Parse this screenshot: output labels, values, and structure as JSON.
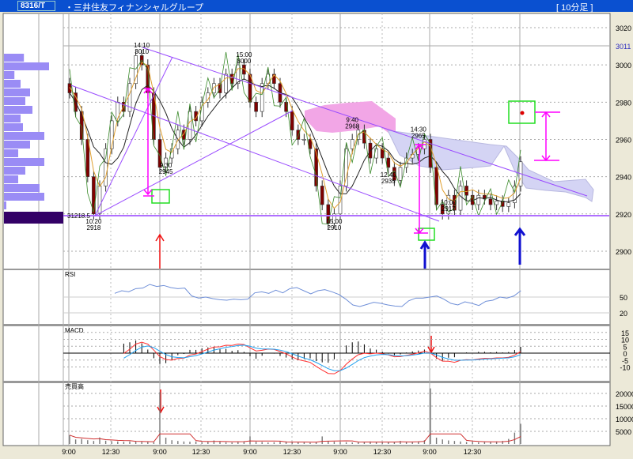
{
  "header": {
    "symbol": "8316/T",
    "name": "・三井住友フィナンシャルグループ",
    "period": "[ 10分足 ]"
  },
  "chart_data": {
    "type": "candlestick",
    "price_axis": {
      "ticks": [
        3020,
        3000,
        2980,
        2960,
        2940,
        2920,
        2900
      ],
      "ylim": [
        2893,
        3027
      ],
      "marker": "3011"
    },
    "time_ticks": [
      "9:00",
      "12:30",
      "9:00",
      "12:30",
      "9:00",
      "12:30",
      "9:00",
      "12:30",
      "9:00",
      "12:30"
    ],
    "closes": [
      2985,
      2975,
      2960,
      2940,
      2920,
      2935,
      2955,
      2970,
      2980,
      2975,
      2990,
      3005,
      3000,
      2985,
      2960,
      2945,
      2950,
      2955,
      2965,
      2960,
      2975,
      2970,
      2980,
      2985,
      2990,
      2985,
      2995,
      2990,
      3000,
      2995,
      2980,
      2975,
      2990,
      2995,
      2990,
      2980,
      2975,
      2965,
      2960,
      2960,
      2955,
      2935,
      2925,
      2915,
      2920,
      2935,
      2955,
      2960,
      2965,
      2958,
      2950,
      2955,
      2950,
      2945,
      2938,
      2945,
      2950,
      2952,
      2955,
      2960,
      2945,
      2925,
      2920,
      2930,
      2922,
      2935,
      2930,
      2925,
      2930,
      2928,
      2925,
      2927,
      2924,
      2926,
      2935,
      2948
    ],
    "annotations": [
      {
        "time": "14:10",
        "price": "3010",
        "bar": 12
      },
      {
        "time": "15:00",
        "price": "3000",
        "bar": 29
      },
      {
        "time": "9:30",
        "price": "2945",
        "bar": 16
      },
      {
        "time": "10:20",
        "price": "2918",
        "bar": 4
      },
      {
        "time": "15:00",
        "price": "2910",
        "bar": 44
      },
      {
        "time": "9:40",
        "price": "2968",
        "bar": 47
      },
      {
        "time": "12:40",
        "price": "2935",
        "bar": 53
      },
      {
        "time": "14:30",
        "price": "2965",
        "bar": 58
      },
      {
        "time": "10:00",
        "price": "2917",
        "bar": 63
      }
    ],
    "support_label": "31218.5",
    "rsi": {
      "label": "RSI",
      "ticks": [
        50,
        20
      ],
      "values": [
        57,
        62,
        60,
        66,
        67,
        74,
        70,
        72,
        68,
        66,
        67,
        52,
        48,
        50,
        47,
        45,
        44,
        46,
        45,
        46,
        58,
        60,
        57,
        63,
        58,
        66,
        68,
        62,
        56,
        62,
        64,
        60,
        55,
        46,
        35,
        32,
        36,
        40,
        38,
        35,
        33,
        32,
        43,
        48,
        48,
        50,
        52,
        46,
        38,
        35,
        41,
        38,
        34,
        42,
        44,
        50,
        48,
        52,
        62
      ]
    },
    "macd": {
      "label": "MACD",
      "ticks": [
        15,
        10,
        5,
        0,
        -5,
        -10
      ]
    },
    "volume": {
      "label": "売買高",
      "ticks": [
        20000,
        15000,
        10000,
        5000
      ],
      "values": [
        3500,
        1800,
        2000,
        1500,
        1200,
        2600,
        1300,
        1100,
        1000,
        900,
        1000,
        1100,
        900,
        800,
        700,
        20500,
        2500,
        1500,
        1200,
        1000,
        900,
        1000,
        800,
        900,
        1400,
        1100,
        700,
        600,
        800,
        1000,
        3000,
        900,
        800,
        600,
        700,
        900,
        1000,
        700,
        800,
        600,
        500,
        800,
        3000,
        1200,
        900,
        800,
        700,
        600,
        700,
        900,
        1000,
        800,
        600,
        700,
        800,
        1200,
        900,
        800,
        1000,
        1500,
        22000,
        2500,
        1800,
        1400,
        1200,
        1000,
        800,
        900,
        700,
        800,
        900,
        1000,
        1200,
        2000,
        4500,
        8000
      ]
    },
    "profile": [
      0.42,
      0.95,
      0.22,
      0.35,
      0.55,
      0.45,
      0.6,
      0.35,
      0.4,
      0.85,
      0.55,
      0.3,
      0.85,
      0.45,
      0.3,
      0.75,
      0.85,
      0.05
    ],
    "colors": {
      "up": "#ffffff",
      "down": "#800000",
      "trend": "#9a4cff",
      "cloud_pink": "#f2a6e6",
      "cloud_blue": "#d4d4f4",
      "rsi": "#6f8fd8",
      "macd": "#ff3030",
      "signal": "#20a0f0"
    }
  }
}
